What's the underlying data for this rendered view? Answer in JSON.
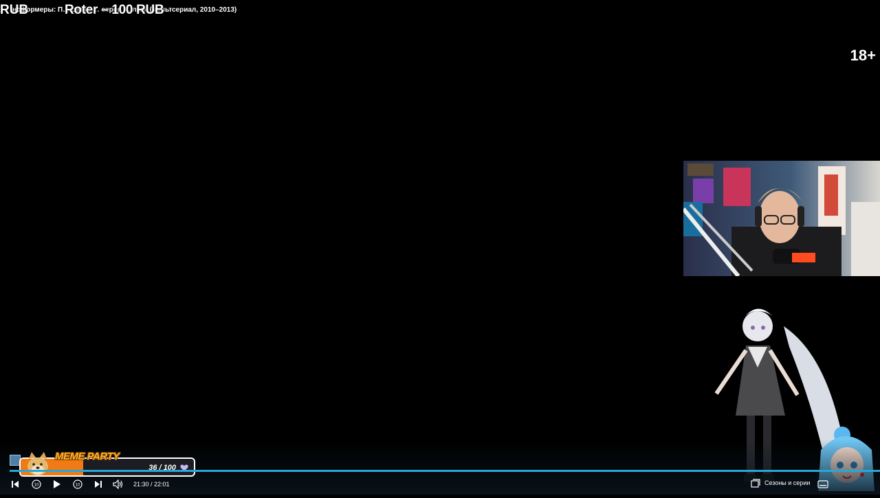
{
  "overlay": {
    "title_prefix": "RUB",
    "title_text": "нсформеры: П… сезон … серия … лка» (мультсериал, 2010–2013)",
    "donation": "Roter – 100 RUB",
    "age_rating": "18+"
  },
  "meme_party": {
    "label": "MEME PARTY",
    "current": 36,
    "total": 100,
    "count_text": "36 / 100",
    "fill_color": "#f07a13"
  },
  "player": {
    "progress": 0.977,
    "time_text": "21:30 / 22:01",
    "seasons_label": "Сезоны и серии",
    "accent_color": "#2aa6d6",
    "controls": {
      "prev": "skip-previous-icon",
      "rewind": "rewind-10-icon",
      "play": "play-icon",
      "forward": "forward-10-icon",
      "next": "skip-next-icon",
      "volume": "volume-icon",
      "seasons": "episodes-icon",
      "subtitles": "subtitles-icon"
    }
  }
}
